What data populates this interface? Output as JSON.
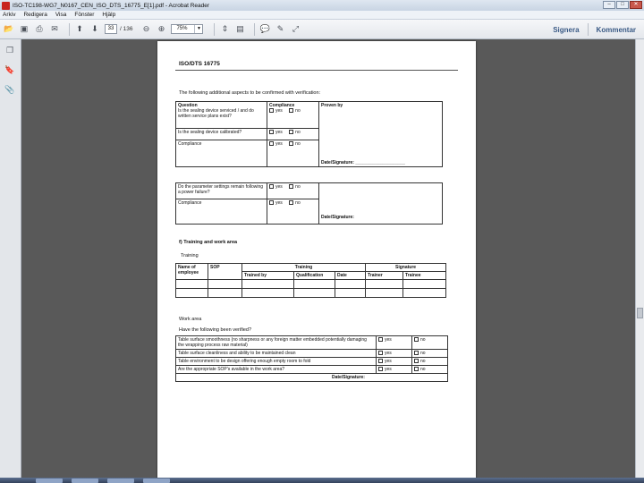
{
  "window": {
    "title": "ISO-TC198-WG7_N0167_CEN_ISO_DTS_16775_E[1].pdf - Acrobat Reader",
    "controls": {
      "minimize": "–",
      "maximize": "□",
      "close": "✕"
    }
  },
  "menu": [
    "Arkiv",
    "Redigera",
    "Visa",
    "Fönster",
    "Hjälp"
  ],
  "toolbar": {
    "page_current": "33",
    "page_total": "/ 136",
    "zoom": "75%",
    "sign_label": "Signera",
    "comment_label": "Kommentar"
  },
  "document": {
    "header": "ISO/DTS 16775",
    "intro": "The following additional aspects to be confirmed with verification:",
    "table1": {
      "col_question": "Question",
      "col_compliance": "Compliance",
      "col_proven": "Proven by",
      "rows": [
        "Is the sealing device serviced / and do written service plans exist?",
        "Is the sealing device calibrated?"
      ],
      "compliance_label": "Compliance",
      "date_sig": "Date/Signature: ____________________"
    },
    "table2": {
      "row": "Do the parameter settings remain following a power failure?",
      "compliance_label": "Compliance",
      "date_sig": "Date/Signature:"
    },
    "yes": "yes",
    "no": "no",
    "section_f": "f) Training and work area",
    "training_label": "Training",
    "training_table": {
      "name_header": "Name of employee",
      "sop_header": "SOP",
      "training_header": "Training",
      "signature_header": "Signature",
      "trained_by": "Trained by",
      "qualification": "Qualification",
      "date": "Date",
      "trainer": "Trainer",
      "trainee": "Trainee"
    },
    "work_area_label": "Work area",
    "work_area_question": "Have the following been verified?",
    "work_area_rows": [
      "Table surface smoothness (no sharpness or any foreign matter embedded potentially damaging the wrapping process raw material)",
      "Table surface cleanliness and ability to be maintained clean",
      "Table environment to be design offering enough empty room to fold",
      "Are the appropriate SOP's available in the work area?"
    ],
    "work_area_sig": "Date/Signature:"
  }
}
